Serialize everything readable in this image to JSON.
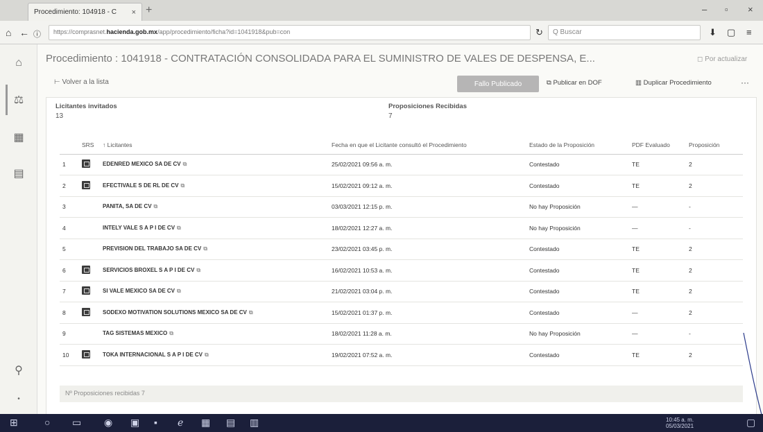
{
  "browser": {
    "tab_title": "Procedimiento: 104918 - C",
    "tab_close": "×",
    "new_tab": "+",
    "url_prefix": "https://comprasnet.",
    "url_domain": "hacienda.gob.mx",
    "url_path": "/app/procedimiento/ficha?id=1041918&pub=con",
    "search_placeholder": "Q Buscar"
  },
  "page": {
    "title": "Procedimiento : 1041918 - CONTRATACIÓN CONSOLIDADA PARA EL SUMINISTRO DE VALES DE DESPENSA, E...",
    "refresh_label": "Por actualizar",
    "back_label": "Volver a la lista",
    "primary_button": "Fallo Publicado",
    "action_publish": "Publicar en DOF",
    "action_duplicate": "Duplicar Procedimiento",
    "more_label": "···"
  },
  "summary": {
    "invited_label": "Licitantes invitados",
    "invited_value": "13",
    "received_label": "Proposiciones Recibidas",
    "received_value": "7"
  },
  "table": {
    "headers": {
      "num": "",
      "sel": "SRS",
      "bidder": "↑ Licitantes",
      "date": "Fecha en que el Licitante consultó el Procedimiento",
      "status": "Estado de la Proposición",
      "pdf": "PDF Evaluado",
      "proposal": "Proposición"
    },
    "rows": [
      {
        "num": "1",
        "checked": true,
        "name": "EDENRED MEXICO SA DE CV",
        "date": "25/02/2021 09:56 a. m.",
        "status": "Contestado",
        "pdf": "TE",
        "prop": "2"
      },
      {
        "num": "2",
        "checked": true,
        "name": "EFECTIVALE S DE RL DE CV",
        "date": "15/02/2021 09:12 a. m.",
        "status": "Contestado",
        "pdf": "TE",
        "prop": "2"
      },
      {
        "num": "3",
        "checked": false,
        "name": "PANITA, SA DE CV",
        "date": "03/03/2021 12:15 p. m.",
        "status": "No hay Proposición",
        "pdf": "—",
        "prop": "-"
      },
      {
        "num": "4",
        "checked": false,
        "name": "INTELY VALE S A P I DE CV",
        "date": "18/02/2021 12:27 a. m.",
        "status": "No hay Proposición",
        "pdf": "—",
        "prop": "-"
      },
      {
        "num": "5",
        "checked": false,
        "name": "PREVISION DEL TRABAJO SA DE CV",
        "date": "23/02/2021 03:45 p. m.",
        "status": "Contestado",
        "pdf": "TE",
        "prop": "2"
      },
      {
        "num": "6",
        "checked": true,
        "name": "SERVICIOS BROXEL S A P I DE CV",
        "date": "16/02/2021 10:53 a. m.",
        "status": "Contestado",
        "pdf": "TE",
        "prop": "2"
      },
      {
        "num": "7",
        "checked": true,
        "name": "SI VALE MEXICO SA DE CV",
        "date": "21/02/2021 03:04 p. m.",
        "status": "Contestado",
        "pdf": "TE",
        "prop": "2"
      },
      {
        "num": "8",
        "checked": true,
        "name": "SODEXO MOTIVATION SOLUTIONS MEXICO SA DE CV",
        "date": "15/02/2021 01:37 p. m.",
        "status": "Contestado",
        "pdf": "—",
        "prop": "2"
      },
      {
        "num": "9",
        "checked": false,
        "name": "TAG SISTEMAS MEXICO",
        "date": "18/02/2021 11:28 a. m.",
        "status": "No hay Proposición",
        "pdf": "—",
        "prop": "-"
      },
      {
        "num": "10",
        "checked": true,
        "name": "TOKA INTERNACIONAL S A P I DE CV",
        "date": "19/02/2021 07:52 a. m.",
        "status": "Contestado",
        "pdf": "TE",
        "prop": "2"
      }
    ]
  },
  "footer": {
    "text": "Nº Proposiciones recibidas 7"
  },
  "taskbar": {
    "time": "10:45 a. m.",
    "date": "05/03/2021"
  },
  "colors": {
    "primary_button": "#b6b5b5",
    "taskbar": "#1b1f3a",
    "checkbox": "#3c3c3c"
  }
}
